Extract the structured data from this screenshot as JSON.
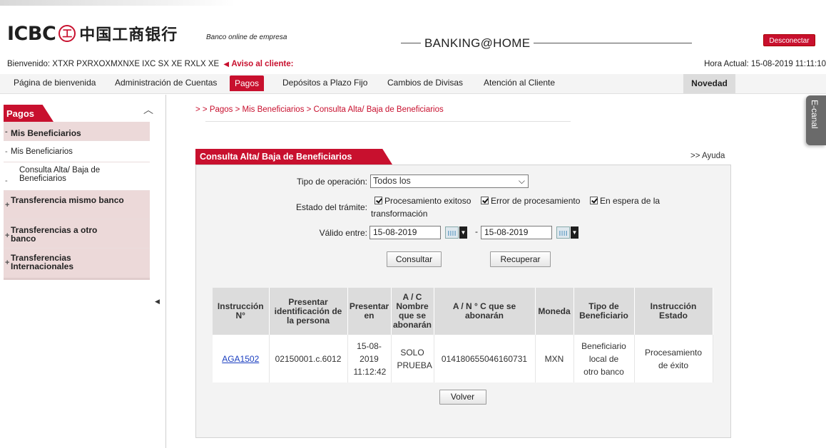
{
  "header": {
    "logo_text": "ICBC",
    "logo_seal": "工",
    "logo_chinese": "中国工商银行",
    "tagline": "Banco online de empresa",
    "brand": "BANKING@HOME",
    "logout_label": "Desconectar",
    "welcome_text": "Bienvenido: XTXR PXRXOXMXNXE IXC SX XE RXLX XE",
    "notice_label": "Aviso al cliente:",
    "clock_text": "Hora Actual: 15-08-2019 11:11:10"
  },
  "nav": {
    "items": [
      "Página de bienvenida",
      "Administración de Cuentas",
      "Pagos",
      "Depósitos a Plazo Fijo",
      "Cambios de Divisas",
      "Atención al Cliente"
    ],
    "active": "Pagos",
    "new_label": "Novedad"
  },
  "sidebar": {
    "title": "Pagos",
    "items": [
      {
        "label": "Mis Beneficiarios",
        "marker": "-"
      },
      {
        "label": "Mis Beneficiarios",
        "marker": "-"
      },
      {
        "label": "Consulta Alta/ Baja de Beneficiarios",
        "marker": "-"
      },
      {
        "label": "Transferencia mismo banco",
        "marker": "+"
      },
      {
        "label": "Transferencias a otro banco",
        "marker": "+"
      },
      {
        "label": "Transferencias Internacionales",
        "marker": "+"
      }
    ]
  },
  "side_tab": "E-canal",
  "breadcrumb": "> > Pagos > Mis Beneficiarios > Consulta Alta/ Baja de Beneficiarios",
  "panel": {
    "title": "Consulta Alta/ Baja de Beneficiarios",
    "help_label": ">> Ayuda"
  },
  "form": {
    "operation_label": "Tipo de operación:",
    "operation_value": "Todos los",
    "status_label": "Estado del trámite:",
    "status_options": [
      {
        "label": "Procesamiento exitoso",
        "checked": true
      },
      {
        "label": "Error de procesamiento",
        "checked": true
      },
      {
        "label": "En espera de la",
        "checked": true
      }
    ],
    "status_wrap_text": "transformación",
    "date_label": "Válido entre:",
    "date_from": "15-08-2019",
    "date_to": "15-08-2019",
    "date_separator": "-",
    "search_label": "Consultar",
    "reset_label": "Recuperar"
  },
  "table": {
    "headers": [
      "Instrucción N°",
      "Presentar identificación de la persona",
      "Presentar en",
      "A / C Nombre que se abonarán",
      "A / N ° C que se abonarán",
      "Moneda",
      "Tipo de Beneficiario",
      "Instrucción Estado"
    ],
    "rows": [
      {
        "instruction": "AGA1502",
        "person_id": "02150001.c.6012",
        "submitted": "15-08-2019 11:12:42",
        "account_name": "SOLO PRUEBA",
        "account_number": "014180655046160731",
        "currency": "MXN",
        "beneficiary_type": "Beneficiario local de otro banco",
        "status": "Procesamiento de éxito"
      }
    ],
    "back_label": "Volver"
  },
  "colors": {
    "accent": "#c8102e",
    "link": "#1a3ec0",
    "table_header": "#dcdcdc",
    "panel_background": "#f3f3f3"
  }
}
